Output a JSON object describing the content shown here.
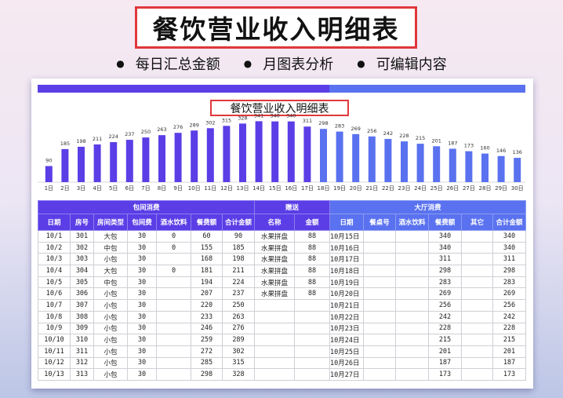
{
  "title": "餐饮营业收入明细表",
  "bullets": [
    "每日汇总金额",
    "月图表分析",
    "可编辑内容"
  ],
  "sheet_title": "餐饮营业收入明细表",
  "colors": {
    "purple": "#5b3ee6",
    "blue": "#5a72ef",
    "red": "#e0383c"
  },
  "chart_data": {
    "type": "bar",
    "title": "餐饮营业收入明细表",
    "categories": [
      "1日",
      "2日",
      "3日",
      "4日",
      "5日",
      "6日",
      "7日",
      "8日",
      "9日",
      "10日",
      "11日",
      "12日",
      "13日",
      "14日",
      "15日",
      "16日",
      "17日",
      "18日",
      "19日",
      "20日",
      "21日",
      "22日",
      "23日",
      "24日",
      "25日",
      "26日",
      "27日",
      "28日",
      "29日",
      "30日"
    ],
    "values": [
      90,
      185,
      198,
      211,
      224,
      237,
      250,
      263,
      276,
      289,
      302,
      315,
      328,
      341,
      340,
      340,
      311,
      298,
      283,
      269,
      256,
      242,
      228,
      215,
      201,
      187,
      173,
      160,
      146,
      136
    ],
    "ylim": [
      0,
      360
    ]
  },
  "table": {
    "groups": [
      "包间消费",
      "赠送",
      "大厅消费"
    ],
    "headers": [
      "日期",
      "房号",
      "房间类型",
      "包间费",
      "酒水饮料",
      "餐费额",
      "合计金额",
      "名称",
      "金额",
      "日期",
      "餐桌号",
      "酒水饮料",
      "餐费额",
      "其它",
      "合计金额"
    ],
    "rows": [
      [
        "10/1",
        "301",
        "大包",
        "30",
        "0",
        "60",
        "90",
        "水果拼盘",
        "88",
        "10月15日",
        "",
        "",
        "340",
        "",
        "340"
      ],
      [
        "10/2",
        "302",
        "中包",
        "30",
        "0",
        "155",
        "185",
        "水果拼盘",
        "88",
        "10月16日",
        "",
        "",
        "340",
        "",
        "340"
      ],
      [
        "10/3",
        "303",
        "小包",
        "30",
        "",
        "168",
        "198",
        "水果拼盘",
        "88",
        "10月17日",
        "",
        "",
        "311",
        "",
        "311"
      ],
      [
        "10/4",
        "304",
        "大包",
        "30",
        "0",
        "181",
        "211",
        "水果拼盘",
        "88",
        "10月18日",
        "",
        "",
        "298",
        "",
        "298"
      ],
      [
        "10/5",
        "305",
        "中包",
        "30",
        "",
        "194",
        "224",
        "水果拼盘",
        "88",
        "10月19日",
        "",
        "",
        "283",
        "",
        "283"
      ],
      [
        "10/6",
        "306",
        "小包",
        "30",
        "",
        "207",
        "237",
        "水果拼盘",
        "88",
        "10月20日",
        "",
        "",
        "269",
        "",
        "269"
      ],
      [
        "10/7",
        "307",
        "小包",
        "30",
        "",
        "220",
        "250",
        "",
        "",
        "10月21日",
        "",
        "",
        "256",
        "",
        "256"
      ],
      [
        "10/8",
        "308",
        "小包",
        "30",
        "",
        "233",
        "263",
        "",
        "",
        "10月22日",
        "",
        "",
        "242",
        "",
        "242"
      ],
      [
        "10/9",
        "309",
        "小包",
        "30",
        "",
        "246",
        "276",
        "",
        "",
        "10月23日",
        "",
        "",
        "228",
        "",
        "228"
      ],
      [
        "10/10",
        "310",
        "小包",
        "30",
        "",
        "259",
        "289",
        "",
        "",
        "10月24日",
        "",
        "",
        "215",
        "",
        "215"
      ],
      [
        "10/11",
        "311",
        "小包",
        "30",
        "",
        "272",
        "302",
        "",
        "",
        "10月25日",
        "",
        "",
        "201",
        "",
        "201"
      ],
      [
        "10/12",
        "312",
        "小包",
        "30",
        "",
        "285",
        "315",
        "",
        "",
        "10月26日",
        "",
        "",
        "187",
        "",
        "187"
      ],
      [
        "10/13",
        "313",
        "小包",
        "30",
        "",
        "298",
        "328",
        "",
        "",
        "10月27日",
        "",
        "",
        "173",
        "",
        "173"
      ]
    ]
  }
}
